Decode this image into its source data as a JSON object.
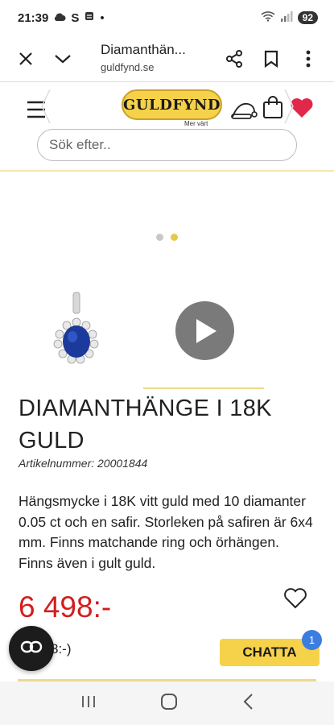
{
  "status_bar": {
    "time": "21:39",
    "letter": "S",
    "dot": "•",
    "battery": "92"
  },
  "tab": {
    "title": "Diamanthän...",
    "url": "guldfynd.se"
  },
  "header": {
    "logo_text": "GULDFYND",
    "logo_tagline": "Mer värt",
    "search_placeholder": "Sök efter.."
  },
  "gallery": {
    "dots": [
      "#c8c8c8",
      "#e4c84a"
    ]
  },
  "product": {
    "title": "DIAMANTHÄNGE I 18K GULD",
    "article": "Artikelnummer: 20001844",
    "description": "Hängsmycke i 18K vitt guld med 10 diamanter 0.05 ct och en safir. Storleken på safiren är 6x4 mm. Finns matchande ring och örhängen. Finns även i gult guld.",
    "price": "6 498:-",
    "partial": "8:-)"
  },
  "chat": {
    "label": "CHATTA",
    "badge": "1"
  },
  "colors": {
    "price": "#d21e1e",
    "logo_gold": "#f6d24a",
    "heart": "#e0284a",
    "badge_blue": "#3b7de0"
  }
}
